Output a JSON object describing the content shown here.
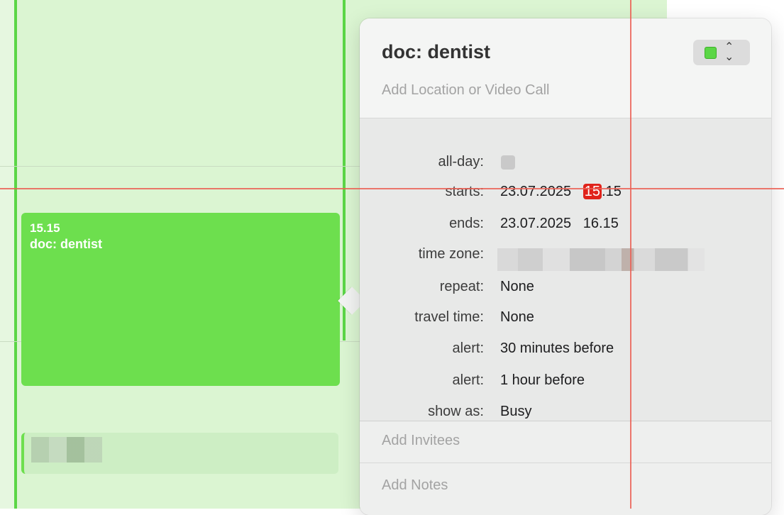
{
  "calendar": {
    "event": {
      "time": "15.15",
      "title": "doc: dentist"
    }
  },
  "popover": {
    "title": "doc: dentist",
    "location_placeholder": "Add Location or Video Call",
    "color": "#5bd646",
    "fields": {
      "all_day_label": "all-day:",
      "starts_label": "starts:",
      "starts_date": "23.07.2025",
      "starts_hour": "15",
      "starts_minutes": ".15",
      "ends_label": "ends:",
      "ends_date": "23.07.2025",
      "ends_time": "16.15",
      "time_zone_label": "time zone:",
      "repeat_label": "repeat:",
      "repeat_value": "None",
      "travel_time_label": "travel time:",
      "travel_time_value": "None",
      "alert_label": "alert:",
      "alert1_value": "30 minutes before",
      "alert2_label": "alert:",
      "alert2_value": "1 hour before",
      "show_as_label": "show as:",
      "show_as_value": "Busy"
    },
    "invitees_placeholder": "Add Invitees",
    "notes_placeholder": "Add Notes"
  }
}
